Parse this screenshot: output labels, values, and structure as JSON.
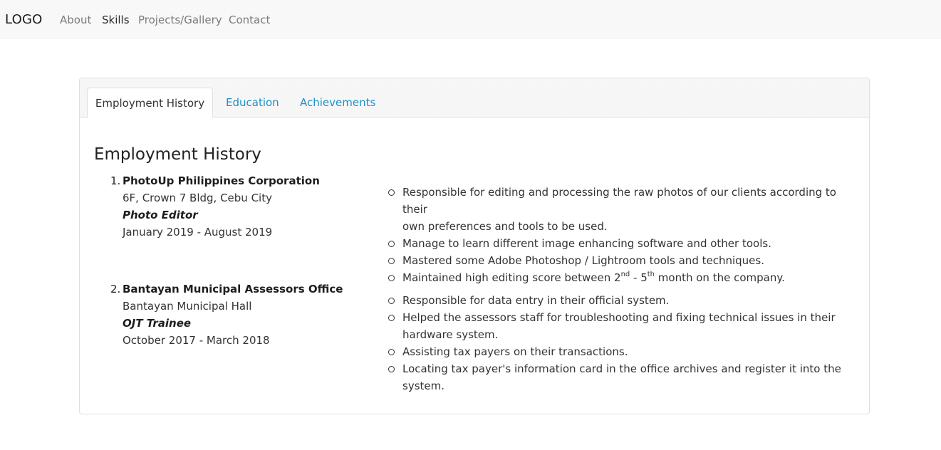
{
  "navbar": {
    "brand": "LOGO",
    "links": [
      {
        "label": "About",
        "active": false
      },
      {
        "label": "Skills",
        "active": true
      },
      {
        "label": "Projects/Gallery",
        "active": false
      },
      {
        "label": "Contact",
        "active": false
      }
    ]
  },
  "tabs": [
    {
      "label": "Employment History",
      "active": true
    },
    {
      "label": "Education",
      "active": false
    },
    {
      "label": "Achievements",
      "active": false
    }
  ],
  "section": {
    "title": "Employment History"
  },
  "jobs": [
    {
      "number": "1.",
      "company": "PhotoUp Philippines Corporation",
      "address": "6F, Crown 7 Bldg, Cebu City",
      "role": "Photo Editor",
      "period": "January 2019 - August 2019",
      "duties": [
        "Responsible for editing and processing the raw photos of our clients according to their",
        "own preferences and tools to be used.",
        "Manage to learn different image enhancing software and other tools.",
        "Mastered some Adobe Photoshop / Lightroom tools and techniques.",
        "Maintained high editing score between 2",
        "nd",
        " - 5",
        "th",
        " month on the company."
      ]
    },
    {
      "number": "2.",
      "company": "Bantayan Municipal Assessors Office",
      "address": "Bantayan Municipal Hall",
      "role": "OJT Trainee",
      "period": "October 2017 - March 2018",
      "duties": [
        "Responsible for data entry in their official system.",
        "Helped the assessors staff for troubleshooting and fixing technical issues in their",
        "hardware system.",
        "Assisting tax payers on their transactions.",
        "Locating tax payer's information card in the office archives and register it into the system."
      ]
    }
  ]
}
